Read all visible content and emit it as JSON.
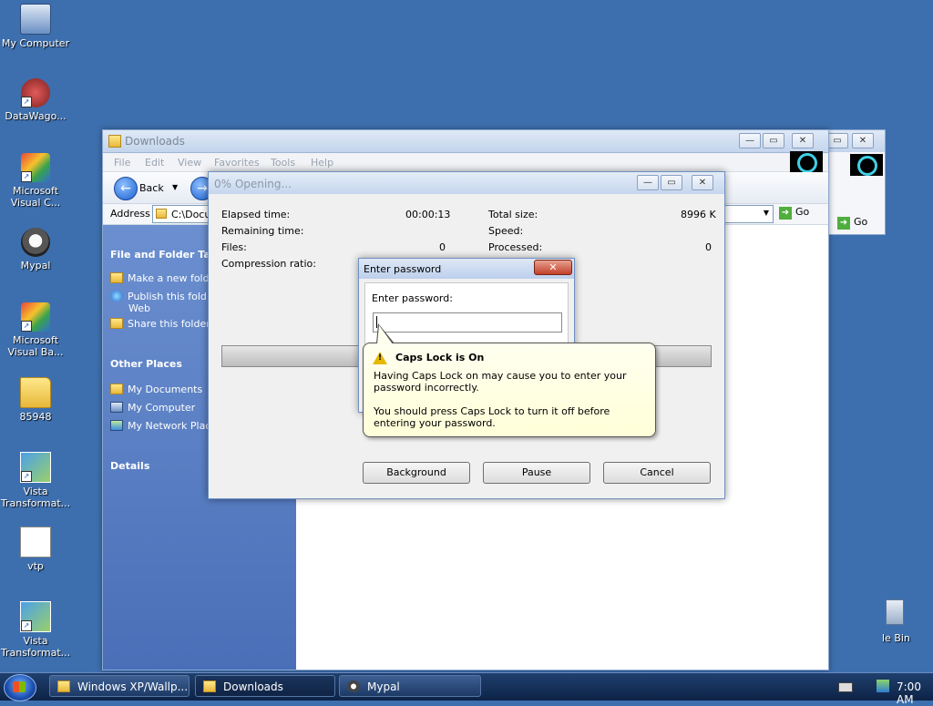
{
  "desktop": {
    "icons": [
      {
        "label": "My Computer"
      },
      {
        "label": "DataWago..."
      },
      {
        "label": "Microsoft Visual C..."
      },
      {
        "label": "Mypal"
      },
      {
        "label": "Microsoft Visual Ba..."
      },
      {
        "label": "85948"
      },
      {
        "label": "Vista Transformat..."
      },
      {
        "label": "vtp"
      },
      {
        "label": "Vista Transformat..."
      }
    ],
    "partial_recycle_label": "le Bin"
  },
  "explorer": {
    "title": "Downloads",
    "menu": [
      "File",
      "Edit",
      "View",
      "Favorites",
      "Tools",
      "Help"
    ],
    "back_label": "Back",
    "address_label": "Address",
    "address_value": "C:\\Docu",
    "go_label": "Go",
    "sidebar": {
      "tasks_header": "File and Folder Tasks",
      "tasks": [
        "Make a new fold",
        "Publish this fold",
        "Web",
        "Share this folder"
      ],
      "places_header": "Other Places",
      "places": [
        "My Documents",
        "My Computer",
        "My Network Plac"
      ],
      "details_header": "Details"
    }
  },
  "opening": {
    "title": "0% Opening...",
    "elapsed_label": "Elapsed time:",
    "elapsed_value": "00:00:13",
    "remaining_label": "Remaining time:",
    "files_label": "Files:",
    "files_value": "0",
    "compression_label": "Compression ratio:",
    "total_label": "Total size:",
    "total_value": "8996 K",
    "speed_label": "Speed:",
    "processed_label": "Processed:",
    "processed_value": "0",
    "progress_fraction": 0,
    "buttons": {
      "background": "Background",
      "pause": "Pause",
      "cancel": "Cancel"
    }
  },
  "password_dialog": {
    "title": "Enter password",
    "prompt": "Enter password:",
    "value": ""
  },
  "balloon": {
    "title": "Caps Lock is On",
    "line1": "Having Caps Lock on may cause you to enter your password incorrectly.",
    "line2": "You should press Caps Lock to turn it off before entering your password."
  },
  "taskbar": {
    "tasks": [
      "Windows XP/Wallp...",
      "Downloads",
      "Mypal"
    ],
    "clock": "7:00 AM"
  }
}
